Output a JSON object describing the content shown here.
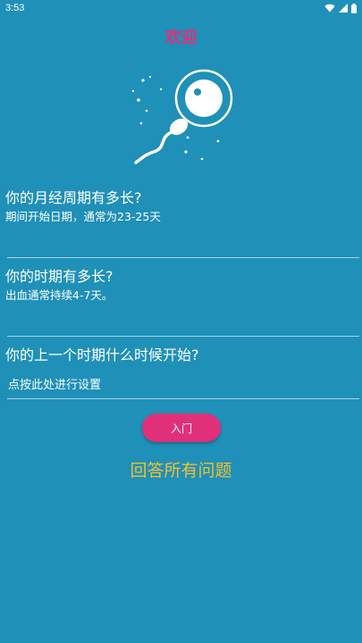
{
  "status_bar": {
    "time": "3:53",
    "icons": [
      "wifi-icon",
      "signal-icon",
      "battery-icon"
    ]
  },
  "welcome": {
    "title": "欢迎"
  },
  "logo": {
    "icon": "sperm-egg-icon"
  },
  "questions": [
    {
      "title": "你的月经周期有多长?",
      "subtitle": "期间开始日期，通常为23-25天",
      "value": ""
    },
    {
      "title": "你的时期有多长?",
      "subtitle": "出血通常持续4-7天。",
      "value": ""
    },
    {
      "title": "你的上一个时期什么时候开始?",
      "value": "点按此处进行设置"
    }
  ],
  "start_button": {
    "label": "入门"
  },
  "answer_hint": "回答所有问题",
  "colors": {
    "background": "#1f90b8",
    "accent": "#e0307a",
    "hint": "#f0c030"
  }
}
